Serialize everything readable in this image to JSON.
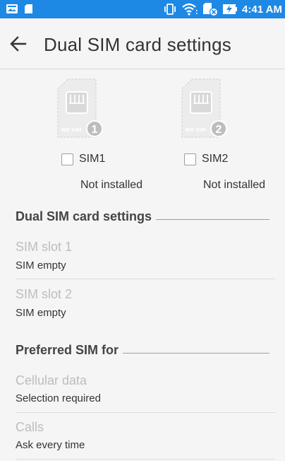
{
  "status_bar": {
    "time": "4:41 AM",
    "left_icons": [
      "image-notification-icon",
      "sd-card-icon"
    ],
    "right_icons": [
      "vibrate-icon",
      "wifi-icon",
      "no-sim-icon",
      "battery-charging-icon"
    ],
    "color": "#1e88e5"
  },
  "header": {
    "title": "Dual SIM card settings",
    "back_icon": "arrow-left-icon"
  },
  "sims": [
    {
      "card_text": "NO SIM",
      "number": "1",
      "checkbox_label": "SIM1",
      "status": "Not installed",
      "checked": false
    },
    {
      "card_text": "NO SIM",
      "number": "2",
      "checkbox_label": "SIM2",
      "status": "Not installed",
      "checked": false
    }
  ],
  "sections": {
    "dual_sim": {
      "title": "Dual SIM card settings",
      "items": [
        {
          "title": "SIM slot 1",
          "summary": "SIM empty"
        },
        {
          "title": "SIM slot 2",
          "summary": "SIM empty"
        }
      ]
    },
    "preferred": {
      "title": "Preferred SIM for",
      "items": [
        {
          "title": "Cellular data",
          "summary": "Selection required"
        },
        {
          "title": "Calls",
          "summary": "Ask every time"
        }
      ]
    }
  }
}
